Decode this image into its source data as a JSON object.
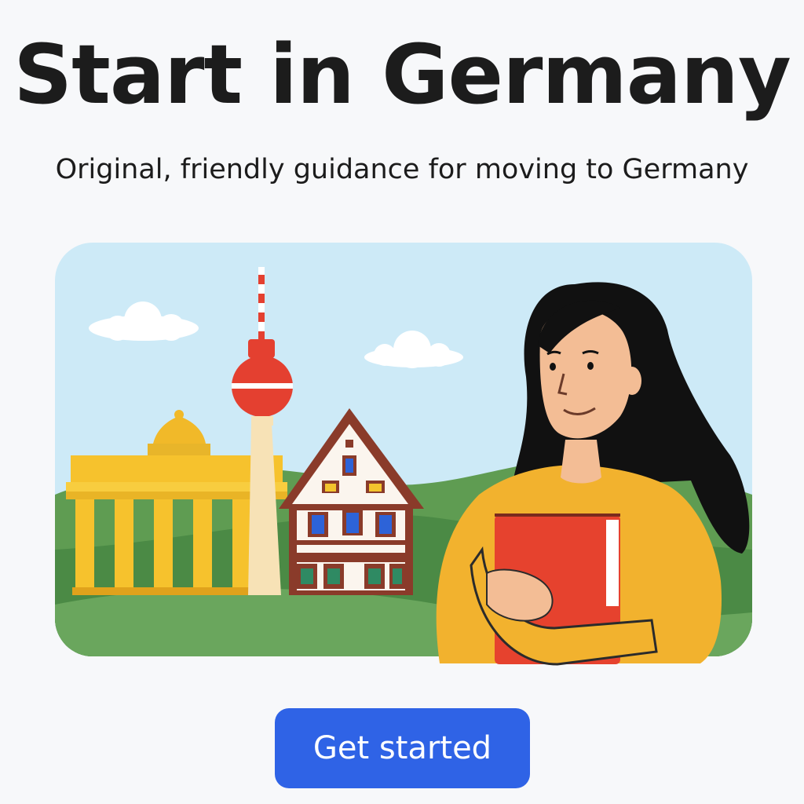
{
  "page": {
    "title": "Start in Germany",
    "subtitle": "Original, friendly guidance for moving to Germany"
  },
  "hero": {
    "illustration": "landmarks-and-newcomer",
    "sky_color": "#cdeaf7",
    "hill_colors": [
      "#5f9c52",
      "#4b8a45",
      "#6aa65d"
    ],
    "landmarks": [
      "brandenburg-gate-icon",
      "tv-tower-icon",
      "timber-house-icon"
    ],
    "person": "woman-with-book-icon"
  },
  "cta": {
    "label": "Get started",
    "color": "#2f63e6"
  }
}
